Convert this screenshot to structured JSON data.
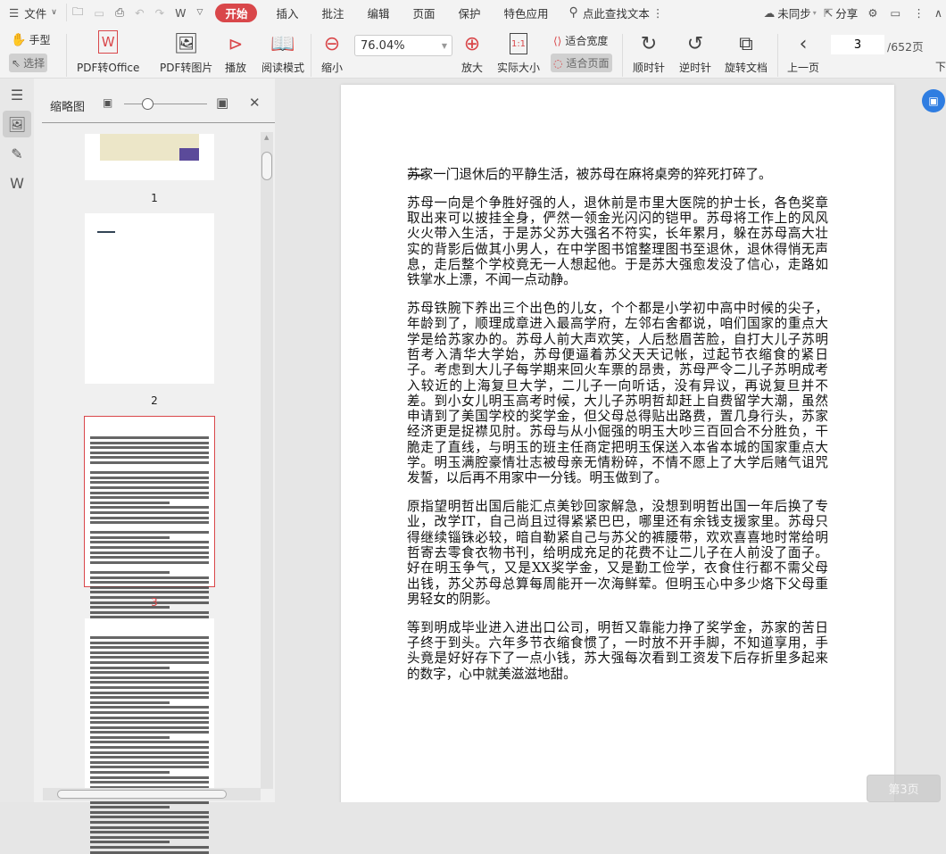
{
  "menu": {
    "file": "文件",
    "tabs": [
      "开始",
      "插入",
      "批注",
      "编辑",
      "页面",
      "保护",
      "特色应用"
    ],
    "search_placeholder": "点此查找文本",
    "sync": "未同步",
    "share": "分享"
  },
  "toolbar": {
    "hand": "手型",
    "select": "选择",
    "pdf_to_office": "PDF转Office",
    "pdf_to_image": "PDF转图片",
    "play": "播放",
    "read_mode": "阅读模式",
    "zoom_out": "缩小",
    "zoom_value": "76.04%",
    "zoom_in": "放大",
    "actual_size": "实际大小",
    "fit_width": "适合宽度",
    "fit_page": "适合页面",
    "rotate_cw": "顺时针",
    "rotate_ccw": "逆时针",
    "rotate_doc": "旋转文档",
    "prev_page": "上一页",
    "next_page": "下",
    "current_page": "3",
    "total_pages": "/652页"
  },
  "thumbnail_panel": {
    "title": "缩略图",
    "pages": [
      "1",
      "2",
      "3"
    ],
    "selected_page": "3"
  },
  "document": {
    "heading": "一",
    "paragraphs": [
      [
        "苏家一门退休后的平静生活，被苏母在麻将桌旁的猝死打碎了。"
      ],
      [
        "苏母一向是个争胜好强的人，退休前是市里大医院的护士长，各色奖章",
        "取出来可以披挂全身，俨然一领金光闪闪的铠甲。苏母将工作上的风风",
        "火火带入生活，于是苏父苏大强名不符实，长年累月，躲在苏母高大壮",
        "实的背影后做其小男人，在中学图书馆整理图书至退休，退休得悄无声",
        "息，走后整个学校竟无一人想起他。于是苏大强愈发没了信心，走路如",
        "铁掌水上漂，不闻一点动静。"
      ],
      [
        "苏母铁腕下养出三个出色的儿女，个个都是小学初中高中时候的尖子，",
        "年龄到了，顺理成章进入最高学府，左邻右舍都说，咱们国家的重点大",
        "学是给苏家办的。苏母人前大声欢笑，人后愁眉苦脸，自打大儿子苏明",
        "哲考入清华大学始，苏母便逼着苏父天天记帐，过起节衣缩食的紧日",
        "子。考虑到大儿子每学期来回火车票的昂贵，苏母严令二儿子苏明成考",
        "入较近的上海复旦大学，二儿子一向听话，没有异议，再说复旦并不",
        "差。到小女儿明玉高考时候，大儿子苏明哲却赶上自费留学大潮，虽然",
        "申请到了美国学校的奖学金，但父母总得贴出路费，置几身行头，苏家",
        "经济更是捉襟见肘。苏母与从小倔强的明玉大吵三百回合不分胜负，干",
        "脆走了直线，与明玉的班主任商定把明玉保送入本省本城的国家重点大",
        "学。明玉满腔豪情壮志被母亲无情粉碎，不情不愿上了大学后赌气诅咒",
        "发誓，以后再不用家中一分钱。明玉做到了。"
      ],
      [
        "原指望明哲出国后能汇点美钞回家解急，没想到明哲出国一年后换了专",
        "业，改学IT，自己尚且过得紧紧巴巴，哪里还有余钱支援家里。苏母只",
        "得继续锱铢必较，暗自勒紧自己与苏父的裤腰带，欢欢喜喜地时常给明",
        "哲寄去零食衣物书刊，给明成充足的花费不让二儿子在人前没了面子。",
        "好在明玉争气，又是XX奖学金，又是勤工俭学，衣食住行都不需父母",
        "出钱，苏父苏母总算每周能开一次海鲜荤。但明玉心中多少烙下父母重",
        "男轻女的阴影。"
      ],
      [
        "等到明成毕业进入进出口公司，明哲又靠能力挣了奖学金，苏家的苦日",
        "子终于到头。六年多节衣缩食惯了，一时放不开手脚，不知道享用，手",
        "头竟是好好存下了一点小钱，苏大强每次看到工资发下后存折里多起来",
        "的数字，心中就美滋滋地甜。"
      ]
    ]
  },
  "page_indicator": "第3页",
  "colors": {
    "accent": "#d9474a",
    "blue": "#2f7de1"
  }
}
